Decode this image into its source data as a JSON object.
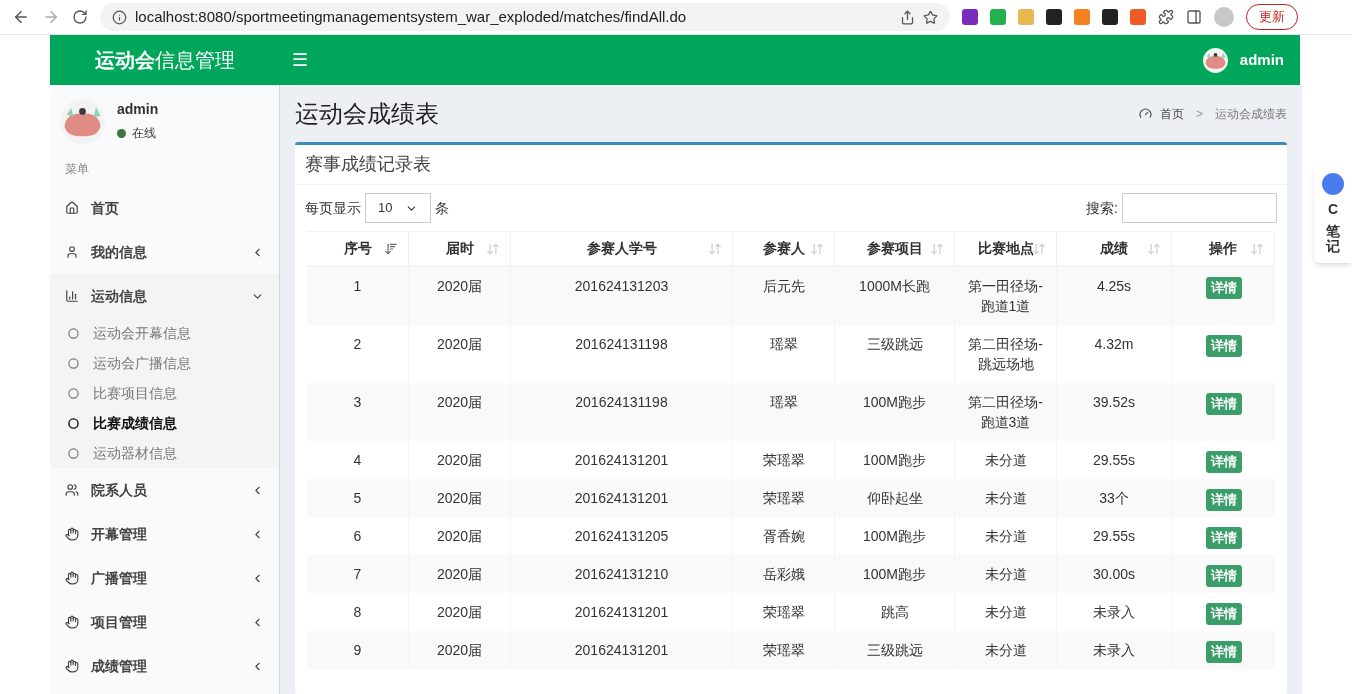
{
  "browser": {
    "url": "localhost:8080/sportmeetingmanagementsystem_war_exploded/matches/findAll.do",
    "update_button": "更新"
  },
  "header": {
    "brand_bold": "运动会",
    "brand_rest": "信息管理",
    "menu_glyph": "☰",
    "user": "admin"
  },
  "sidebar": {
    "user": {
      "name": "admin",
      "status": "在线"
    },
    "menu_title": "菜单",
    "items": [
      {
        "label": "首页"
      },
      {
        "label": "我的信息",
        "expanded": false
      },
      {
        "label": "运动信息",
        "expanded": true,
        "children": [
          {
            "label": "运动会开幕信息",
            "selected": false
          },
          {
            "label": "运动会广播信息",
            "selected": false
          },
          {
            "label": "比赛项目信息",
            "selected": false
          },
          {
            "label": "比赛成绩信息",
            "selected": true
          },
          {
            "label": "运动器材信息",
            "selected": false
          }
        ]
      },
      {
        "label": "院系人员",
        "expanded": false
      },
      {
        "label": "开幕管理",
        "expanded": false
      },
      {
        "label": "广播管理",
        "expanded": false
      },
      {
        "label": "项目管理",
        "expanded": false
      },
      {
        "label": "成绩管理",
        "expanded": false
      }
    ]
  },
  "page": {
    "title": "运动会成绩表",
    "breadcrumb": [
      "首页",
      "运动会成绩表"
    ],
    "breadcrumb_separator": ">"
  },
  "box": {
    "title": "赛事成绩记录表",
    "page_size_label": "每页显示",
    "page_size": "10",
    "page_size_unit": "条",
    "search_label": "搜索:",
    "columns": [
      {
        "label": "序号",
        "sorted": true
      },
      {
        "label": "届时",
        "sorted": false
      },
      {
        "label": "参赛人学号",
        "sorted": false
      },
      {
        "label": "参赛人",
        "sorted": false
      },
      {
        "label": "参赛项目",
        "sorted": false
      },
      {
        "label": "比赛地点",
        "sorted": false
      },
      {
        "label": "成绩",
        "sorted": false
      },
      {
        "label": "操作",
        "sorted": false
      }
    ],
    "rows": [
      {
        "cells": [
          "1",
          "2020届",
          "201624131203",
          "后元先",
          "1000M长跑",
          "第一田径场-跑道1道",
          "4.25s"
        ],
        "action": "详情"
      },
      {
        "cells": [
          "2",
          "2020届",
          "201624131198",
          "瑶翠",
          "三级跳远",
          "第二田径场-跳远场地",
          "4.32m"
        ],
        "action": "详情"
      },
      {
        "cells": [
          "3",
          "2020届",
          "201624131198",
          "瑶翠",
          "100M跑步",
          "第二田径场-跑道3道",
          "39.52s"
        ],
        "action": "详情"
      },
      {
        "cells": [
          "4",
          "2020届",
          "201624131201",
          "荣瑶翠",
          "100M跑步",
          "未分道",
          "29.55s"
        ],
        "action": "详情"
      },
      {
        "cells": [
          "5",
          "2020届",
          "201624131201",
          "荣瑶翠",
          "仰卧起坐",
          "未分道",
          "33个"
        ],
        "action": "详情"
      },
      {
        "cells": [
          "6",
          "2020届",
          "201624131205",
          "胥香婉",
          "100M跑步",
          "未分道",
          "29.55s"
        ],
        "action": "详情"
      },
      {
        "cells": [
          "7",
          "2020届",
          "201624131210",
          "岳彩娥",
          "100M跑步",
          "未分道",
          "30.00s"
        ],
        "action": "详情"
      },
      {
        "cells": [
          "8",
          "2020届",
          "201624131201",
          "荣瑶翠",
          "跳高",
          "未分道",
          "未录入"
        ],
        "action": "详情"
      },
      {
        "cells": [
          "9",
          "2020届",
          "201624131201",
          "荣瑶翠",
          "三级跳远",
          "未分道",
          "未录入"
        ],
        "action": "详情"
      }
    ]
  },
  "side_widget": {
    "letter": "C",
    "text": "笔记"
  }
}
